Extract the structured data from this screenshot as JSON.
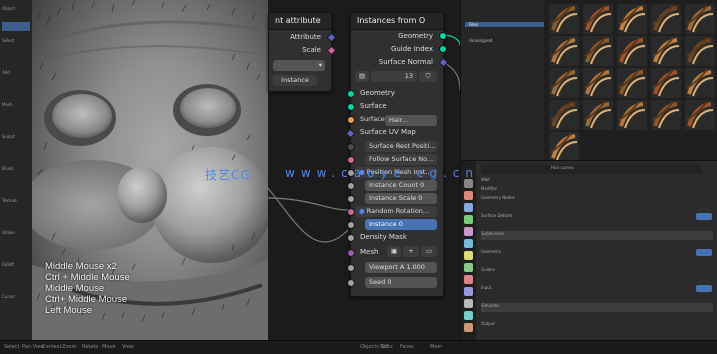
{
  "left_toolbar": {
    "rows": [
      "Object",
      "",
      "Select",
      "",
      "Add",
      "",
      "Mesh",
      "",
      "Sculpt",
      "",
      "Brush",
      "",
      "Texture",
      "",
      "Stroke",
      "",
      "Falloff",
      "",
      "Cursor",
      "",
      ""
    ]
  },
  "viewport": {
    "shortcuts": [
      "Middle Mouse x2",
      "Ctrl + Middle Mouse",
      "Middle Mouse",
      "Ctrl+ Middle Mouse",
      "Left Mouse"
    ]
  },
  "node_editor": {
    "node_a": {
      "title": "nt attribute",
      "outputs": [
        "Attribute",
        "Scale"
      ],
      "dropdown": "",
      "button": "Instance"
    },
    "node_b": {
      "title": "Instances from O",
      "outputs": [
        "Geometry",
        "Guide Index",
        "Surface Normal"
      ],
      "toolbar_value": "13",
      "inputs": [
        "Geometry",
        "Surface"
      ],
      "surface_field": "Hair...",
      "surface_uv_label": "Surface UV Map",
      "surface_rest_field": "Surface Rest Positi...",
      "follow_label": "Follow Surface No...",
      "density_field": "Position Mesh Inst...",
      "density_value": "Instance Count 0",
      "scale_field": "Instance Scale 0",
      "random_field": "Random Rotation...",
      "attr_field": "Instance 0",
      "mask_label": "Density Mask",
      "mesh_label": "Mesh",
      "viewport_amount": "Viewport A   1.000",
      "seed": "Seed   0"
    }
  },
  "asset_browser": {
    "sidebar_items": [
      "Files",
      "Unassigned"
    ],
    "active_item": 0
  },
  "properties": {
    "header": "Hair curves",
    "rows": [
      "Wait",
      "Modifier",
      "Geometry Nodes",
      "",
      "Surface Deform",
      "",
      "Subdivision",
      "",
      "Geometry",
      "",
      "Guides",
      "",
      "Input",
      "",
      "Simulate",
      "",
      "Output",
      ""
    ]
  },
  "statusbar": {
    "items": [
      "Select",
      "Pan View",
      "Context",
      "Zoom",
      "Rotate",
      "Move",
      "View",
      "",
      "Objects 1/1",
      "Verts",
      "Faces",
      "Mem"
    ]
  },
  "watermark": {
    "cn": "技艺CG",
    "url": "www.caoye cg.cn"
  },
  "colors": {
    "geometry_socket": "#00d6a3",
    "vector_socket": "#6363c7",
    "float_socket": "#a1a1a1",
    "object_socket": "#ed9e5c",
    "field_blue": "#4772b3",
    "pink_socket": "#cc6699"
  }
}
